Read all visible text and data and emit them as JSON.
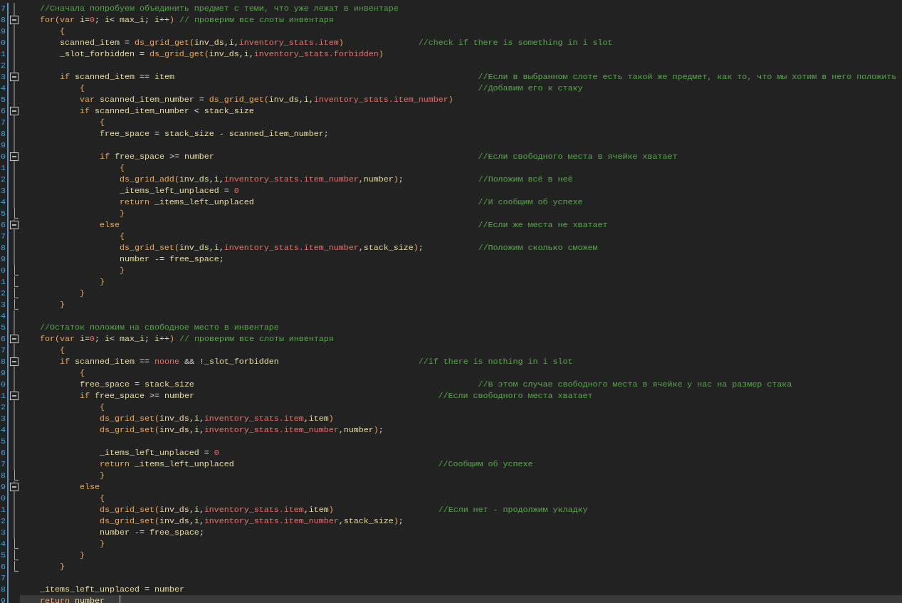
{
  "editor": {
    "lines": [
      {
        "number": "7",
        "kind": "guide",
        "current": false,
        "comment": "//Сначала попробуем объединить предмет с теми, что уже лежат в инвентаре"
      },
      {
        "number": "8",
        "kind": "fold",
        "current": false,
        "code": [
          {
            "kind": "keyword",
            "text": "for"
          },
          {
            "kind": "brace",
            "text": "("
          },
          {
            "kind": "keyword",
            "text": "var"
          },
          {
            "kind": "variable",
            "text": " i"
          },
          {
            "kind": "punctuation",
            "text": "="
          },
          {
            "kind": "number",
            "text": "0"
          },
          {
            "kind": "punctuation",
            "text": ";"
          },
          {
            "kind": "variable",
            "text": " i"
          },
          {
            "kind": "punctuation",
            "text": "<"
          },
          {
            "kind": "variable",
            "text": " max_i"
          },
          {
            "kind": "punctuation",
            "text": ";"
          },
          {
            "kind": "variable",
            "text": " i"
          },
          {
            "kind": "punctuation",
            "text": "++"
          },
          {
            "kind": "brace",
            "text": ")"
          }
        ],
        "comment": " // проверим все слоты инвентаря"
      },
      {
        "number": "9",
        "kind": "guide",
        "current": false,
        "code": [
          {
            "kind": "brace",
            "text": "    {"
          }
        ]
      },
      {
        "number": "0",
        "kind": "guide",
        "current": false,
        "code": [
          {
            "kind": "variable",
            "text": "    scanned_item"
          },
          {
            "kind": "punctuation",
            "text": " ="
          },
          {
            "kind": "function",
            "text": " ds_grid_get"
          },
          {
            "kind": "brace",
            "text": "("
          },
          {
            "kind": "variable",
            "text": "inv_ds"
          },
          {
            "kind": "punctuation",
            "text": ","
          },
          {
            "kind": "variable",
            "text": "i"
          },
          {
            "kind": "punctuation",
            "text": ","
          },
          {
            "kind": "member",
            "text": "inventory_stats.item"
          },
          {
            "kind": "brace",
            "text": ")"
          }
        ],
        "comment": "               //check if there is something in i slot"
      },
      {
        "number": "1",
        "kind": "guide",
        "current": false,
        "code": [
          {
            "kind": "variable",
            "text": "    _slot_forbidden"
          },
          {
            "kind": "punctuation",
            "text": " ="
          },
          {
            "kind": "function",
            "text": " ds_grid_get"
          },
          {
            "kind": "brace",
            "text": "("
          },
          {
            "kind": "variable",
            "text": "inv_ds"
          },
          {
            "kind": "punctuation",
            "text": ","
          },
          {
            "kind": "variable",
            "text": "i"
          },
          {
            "kind": "punctuation",
            "text": ","
          },
          {
            "kind": "member",
            "text": "inventory_stats.forbidden"
          },
          {
            "kind": "brace",
            "text": ")"
          }
        ]
      },
      {
        "number": "2",
        "kind": "guide",
        "current": false
      },
      {
        "number": "3",
        "kind": "fold",
        "current": false,
        "code": [
          {
            "kind": "keyword",
            "text": "    if"
          },
          {
            "kind": "variable",
            "text": " scanned_item"
          },
          {
            "kind": "punctuation",
            "text": " =="
          },
          {
            "kind": "variable",
            "text": " item"
          }
        ],
        "comment": "                                                             //Если в выбранном слоте есть такой же предмет, как то, что мы хотим в него положить"
      },
      {
        "number": "4",
        "kind": "guide",
        "current": false,
        "code": [
          {
            "kind": "brace",
            "text": "        {"
          }
        ],
        "comment": "                                                                               //Добавим его к стаку"
      },
      {
        "number": "5",
        "kind": "guide",
        "current": false,
        "code": [
          {
            "kind": "keyword",
            "text": "        var"
          },
          {
            "kind": "variable",
            "text": " scanned_item_number"
          },
          {
            "kind": "punctuation",
            "text": " ="
          },
          {
            "kind": "function",
            "text": " ds_grid_get"
          },
          {
            "kind": "brace",
            "text": "("
          },
          {
            "kind": "variable",
            "text": "inv_ds"
          },
          {
            "kind": "punctuation",
            "text": ","
          },
          {
            "kind": "variable",
            "text": "i"
          },
          {
            "kind": "punctuation",
            "text": ","
          },
          {
            "kind": "member",
            "text": "inventory_stats.item_number"
          },
          {
            "kind": "brace",
            "text": ")"
          }
        ]
      },
      {
        "number": "6",
        "kind": "fold",
        "current": false,
        "code": [
          {
            "kind": "keyword",
            "text": "        if"
          },
          {
            "kind": "variable",
            "text": " scanned_item_number"
          },
          {
            "kind": "punctuation",
            "text": " <"
          },
          {
            "kind": "variable",
            "text": " stack_size"
          }
        ]
      },
      {
        "number": "7",
        "kind": "guide",
        "current": false,
        "code": [
          {
            "kind": "brace",
            "text": "            {"
          }
        ]
      },
      {
        "number": "8",
        "kind": "guide",
        "current": false,
        "code": [
          {
            "kind": "variable",
            "text": "            free_space"
          },
          {
            "kind": "punctuation",
            "text": " ="
          },
          {
            "kind": "variable",
            "text": " stack_size"
          },
          {
            "kind": "punctuation",
            "text": " -"
          },
          {
            "kind": "variable",
            "text": " scanned_item_number"
          },
          {
            "kind": "punctuation",
            "text": ";"
          }
        ]
      },
      {
        "number": "9",
        "kind": "guide",
        "current": false
      },
      {
        "number": "0",
        "kind": "fold",
        "current": false,
        "code": [
          {
            "kind": "keyword",
            "text": "            if"
          },
          {
            "kind": "variable",
            "text": " free_space"
          },
          {
            "kind": "punctuation",
            "text": " >="
          },
          {
            "kind": "variable",
            "text": " number"
          }
        ],
        "comment": "                                                     //Если свободного места в ячейке хватает"
      },
      {
        "number": "1",
        "kind": "guide",
        "current": false,
        "code": [
          {
            "kind": "brace",
            "text": "                {"
          }
        ]
      },
      {
        "number": "2",
        "kind": "guide",
        "current": false,
        "code": [
          {
            "kind": "function",
            "text": "                ds_grid_add"
          },
          {
            "kind": "brace",
            "text": "("
          },
          {
            "kind": "variable",
            "text": "inv_ds"
          },
          {
            "kind": "punctuation",
            "text": ","
          },
          {
            "kind": "variable",
            "text": "i"
          },
          {
            "kind": "punctuation",
            "text": ","
          },
          {
            "kind": "member",
            "text": "inventory_stats.item_number"
          },
          {
            "kind": "punctuation",
            "text": ","
          },
          {
            "kind": "variable",
            "text": "number"
          },
          {
            "kind": "brace",
            "text": ")"
          },
          {
            "kind": "punctuation",
            "text": ";"
          }
        ],
        "comment": "               //Положим всё в неё"
      },
      {
        "number": "3",
        "kind": "guide",
        "current": false,
        "code": [
          {
            "kind": "variable",
            "text": "                _items_left_unplaced"
          },
          {
            "kind": "punctuation",
            "text": " ="
          },
          {
            "kind": "number",
            "text": " 0"
          }
        ]
      },
      {
        "number": "4",
        "kind": "guide",
        "current": false,
        "code": [
          {
            "kind": "keyword",
            "text": "                return"
          },
          {
            "kind": "variable",
            "text": " _items_left_unplaced"
          }
        ],
        "comment": "                                             //И сообщим об успехе"
      },
      {
        "number": "5",
        "kind": "end",
        "current": false,
        "code": [
          {
            "kind": "brace",
            "text": "                }"
          }
        ]
      },
      {
        "number": "6",
        "kind": "fold",
        "current": false,
        "code": [
          {
            "kind": "keyword",
            "text": "            else"
          }
        ],
        "comment": "                                                                        //Если же места не хватает"
      },
      {
        "number": "7",
        "kind": "guide",
        "current": false,
        "code": [
          {
            "kind": "brace",
            "text": "                {"
          }
        ]
      },
      {
        "number": "8",
        "kind": "guide",
        "current": false,
        "code": [
          {
            "kind": "function",
            "text": "                ds_grid_set"
          },
          {
            "kind": "brace",
            "text": "("
          },
          {
            "kind": "variable",
            "text": "inv_ds"
          },
          {
            "kind": "punctuation",
            "text": ","
          },
          {
            "kind": "variable",
            "text": "i"
          },
          {
            "kind": "punctuation",
            "text": ","
          },
          {
            "kind": "member",
            "text": "inventory_stats.item_number"
          },
          {
            "kind": "punctuation",
            "text": ","
          },
          {
            "kind": "variable",
            "text": "stack_size"
          },
          {
            "kind": "brace",
            "text": ")"
          },
          {
            "kind": "punctuation",
            "text": ";"
          }
        ],
        "comment": "           //Положим сколько сможем"
      },
      {
        "number": "9",
        "kind": "guide",
        "current": false,
        "code": [
          {
            "kind": "variable",
            "text": "                number"
          },
          {
            "kind": "punctuation",
            "text": " -="
          },
          {
            "kind": "variable",
            "text": " free_space"
          },
          {
            "kind": "punctuation",
            "text": ";"
          }
        ]
      },
      {
        "number": "0",
        "kind": "end",
        "current": false,
        "code": [
          {
            "kind": "brace",
            "text": "                }"
          }
        ]
      },
      {
        "number": "1",
        "kind": "end",
        "current": false,
        "code": [
          {
            "kind": "brace",
            "text": "            }"
          }
        ]
      },
      {
        "number": "2",
        "kind": "end",
        "current": false,
        "code": [
          {
            "kind": "brace",
            "text": "        }"
          }
        ]
      },
      {
        "number": "3",
        "kind": "end",
        "current": false,
        "code": [
          {
            "kind": "brace",
            "text": "    }"
          }
        ]
      },
      {
        "number": "4",
        "kind": "guide",
        "current": false
      },
      {
        "number": "5",
        "kind": "guide",
        "current": false,
        "comment": "//Остаток положим на свободное место в инвентаре"
      },
      {
        "number": "6",
        "kind": "fold",
        "current": false,
        "code": [
          {
            "kind": "keyword",
            "text": "for"
          },
          {
            "kind": "brace",
            "text": "("
          },
          {
            "kind": "keyword",
            "text": "var"
          },
          {
            "kind": "variable",
            "text": " i"
          },
          {
            "kind": "punctuation",
            "text": "="
          },
          {
            "kind": "number",
            "text": "0"
          },
          {
            "kind": "punctuation",
            "text": ";"
          },
          {
            "kind": "variable",
            "text": " i"
          },
          {
            "kind": "punctuation",
            "text": "<"
          },
          {
            "kind": "variable",
            "text": " max_i"
          },
          {
            "kind": "punctuation",
            "text": ";"
          },
          {
            "kind": "variable",
            "text": " i"
          },
          {
            "kind": "punctuation",
            "text": "++"
          },
          {
            "kind": "brace",
            "text": ")"
          }
        ],
        "comment": " // проверим все слоты инвентаря"
      },
      {
        "number": "7",
        "kind": "guide",
        "current": false,
        "code": [
          {
            "kind": "brace",
            "text": "    {"
          }
        ]
      },
      {
        "number": "8",
        "kind": "fold",
        "current": false,
        "code": [
          {
            "kind": "keyword",
            "text": "    if"
          },
          {
            "kind": "variable",
            "text": " scanned_item"
          },
          {
            "kind": "punctuation",
            "text": " =="
          },
          {
            "kind": "number",
            "text": " noone"
          },
          {
            "kind": "punctuation",
            "text": " && !"
          },
          {
            "kind": "variable",
            "text": "_slot_forbidden"
          }
        ],
        "comment": "                            //if there is nothing in i slot"
      },
      {
        "number": "9",
        "kind": "guide",
        "current": false,
        "code": [
          {
            "kind": "brace",
            "text": "        {"
          }
        ]
      },
      {
        "number": "0",
        "kind": "guide",
        "current": false,
        "code": [
          {
            "kind": "variable",
            "text": "        free_space"
          },
          {
            "kind": "punctuation",
            "text": " ="
          },
          {
            "kind": "variable",
            "text": " stack_size"
          }
        ],
        "comment": "                                                         //В этом случае свободного места в ячейке у нас на размер стака"
      },
      {
        "number": "1",
        "kind": "fold",
        "current": false,
        "code": [
          {
            "kind": "keyword",
            "text": "        if"
          },
          {
            "kind": "variable",
            "text": " free_space"
          },
          {
            "kind": "punctuation",
            "text": " >="
          },
          {
            "kind": "variable",
            "text": " number"
          }
        ],
        "comment": "                                                 //Если свободного места хватает"
      },
      {
        "number": "2",
        "kind": "guide",
        "current": false,
        "code": [
          {
            "kind": "brace",
            "text": "            {"
          }
        ]
      },
      {
        "number": "3",
        "kind": "guide",
        "current": false,
        "code": [
          {
            "kind": "function",
            "text": "            ds_grid_set"
          },
          {
            "kind": "brace",
            "text": "("
          },
          {
            "kind": "variable",
            "text": "inv_ds"
          },
          {
            "kind": "punctuation",
            "text": ","
          },
          {
            "kind": "variable",
            "text": "i"
          },
          {
            "kind": "punctuation",
            "text": ","
          },
          {
            "kind": "member",
            "text": "inventory_stats.item"
          },
          {
            "kind": "punctuation",
            "text": ","
          },
          {
            "kind": "variable",
            "text": "item"
          },
          {
            "kind": "brace",
            "text": ")"
          }
        ]
      },
      {
        "number": "4",
        "kind": "guide",
        "current": false,
        "code": [
          {
            "kind": "function",
            "text": "            ds_grid_set"
          },
          {
            "kind": "brace",
            "text": "("
          },
          {
            "kind": "variable",
            "text": "inv_ds"
          },
          {
            "kind": "punctuation",
            "text": ","
          },
          {
            "kind": "variable",
            "text": "i"
          },
          {
            "kind": "punctuation",
            "text": ","
          },
          {
            "kind": "member",
            "text": "inventory_stats.item_number"
          },
          {
            "kind": "punctuation",
            "text": ","
          },
          {
            "kind": "variable",
            "text": "number"
          },
          {
            "kind": "brace",
            "text": ")"
          },
          {
            "kind": "punctuation",
            "text": ";"
          }
        ]
      },
      {
        "number": "5",
        "kind": "guide",
        "current": false
      },
      {
        "number": "6",
        "kind": "guide",
        "current": false,
        "code": [
          {
            "kind": "variable",
            "text": "            _items_left_unplaced"
          },
          {
            "kind": "punctuation",
            "text": " ="
          },
          {
            "kind": "number",
            "text": " 0"
          }
        ]
      },
      {
        "number": "7",
        "kind": "guide",
        "current": false,
        "code": [
          {
            "kind": "keyword",
            "text": "            return"
          },
          {
            "kind": "variable",
            "text": " _items_left_unplaced"
          }
        ],
        "comment": "                                         //Сообщим об успехе"
      },
      {
        "number": "8",
        "kind": "end",
        "current": false,
        "code": [
          {
            "kind": "brace",
            "text": "            }"
          }
        ]
      },
      {
        "number": "9",
        "kind": "fold",
        "current": false,
        "code": [
          {
            "kind": "keyword",
            "text": "        else"
          }
        ]
      },
      {
        "number": "0",
        "kind": "guide",
        "current": false,
        "code": [
          {
            "kind": "brace",
            "text": "            {"
          }
        ]
      },
      {
        "number": "1",
        "kind": "guide",
        "current": false,
        "code": [
          {
            "kind": "function",
            "text": "            ds_grid_set"
          },
          {
            "kind": "brace",
            "text": "("
          },
          {
            "kind": "variable",
            "text": "inv_ds"
          },
          {
            "kind": "punctuation",
            "text": ","
          },
          {
            "kind": "variable",
            "text": "i"
          },
          {
            "kind": "punctuation",
            "text": ","
          },
          {
            "kind": "member",
            "text": "inventory_stats.item"
          },
          {
            "kind": "punctuation",
            "text": ","
          },
          {
            "kind": "variable",
            "text": "item"
          },
          {
            "kind": "brace",
            "text": ")"
          }
        ],
        "comment": "                     //Если нет - продолжим укладку"
      },
      {
        "number": "2",
        "kind": "guide",
        "current": false,
        "code": [
          {
            "kind": "function",
            "text": "            ds_grid_set"
          },
          {
            "kind": "brace",
            "text": "("
          },
          {
            "kind": "variable",
            "text": "inv_ds"
          },
          {
            "kind": "punctuation",
            "text": ","
          },
          {
            "kind": "variable",
            "text": "i"
          },
          {
            "kind": "punctuation",
            "text": ","
          },
          {
            "kind": "member",
            "text": "inventory_stats.item_number"
          },
          {
            "kind": "punctuation",
            "text": ","
          },
          {
            "kind": "variable",
            "text": "stack_size"
          },
          {
            "kind": "brace",
            "text": ")"
          },
          {
            "kind": "punctuation",
            "text": ";"
          }
        ]
      },
      {
        "number": "3",
        "kind": "guide",
        "current": false,
        "code": [
          {
            "kind": "variable",
            "text": "            number"
          },
          {
            "kind": "punctuation",
            "text": " -="
          },
          {
            "kind": "variable",
            "text": " free_space"
          },
          {
            "kind": "punctuation",
            "text": ";"
          }
        ]
      },
      {
        "number": "4",
        "kind": "end",
        "current": false,
        "code": [
          {
            "kind": "brace",
            "text": "            }"
          }
        ]
      },
      {
        "number": "5",
        "kind": "end",
        "current": false,
        "code": [
          {
            "kind": "brace",
            "text": "        }"
          }
        ]
      },
      {
        "number": "6",
        "kind": "end",
        "current": false,
        "code": [
          {
            "kind": "brace",
            "text": "    }"
          }
        ]
      },
      {
        "number": "7",
        "kind": "plain",
        "current": false
      },
      {
        "number": "8",
        "kind": "plain",
        "current": false,
        "code": [
          {
            "kind": "variable",
            "text": "_items_left_unplaced"
          },
          {
            "kind": "punctuation",
            "text": " ="
          },
          {
            "kind": "variable",
            "text": " number"
          }
        ]
      },
      {
        "number": "9",
        "kind": "plain",
        "current": true,
        "code": [
          {
            "kind": "keyword",
            "text": "return"
          },
          {
            "kind": "variable",
            "text": " number"
          }
        ]
      }
    ]
  }
}
